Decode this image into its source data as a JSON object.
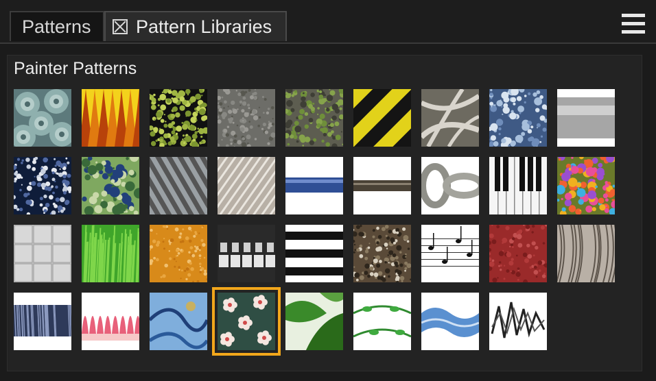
{
  "tabs": [
    {
      "label": "Patterns"
    },
    {
      "label": "Pattern Libraries"
    }
  ],
  "icons": {
    "tab_close": "close-box-icon",
    "panel_menu": "hamburger-menu-icon"
  },
  "accent_color": "#f2a71b",
  "section": {
    "title": "Painter Patterns"
  },
  "patterns": [
    {
      "name": "succulent"
    },
    {
      "name": "flames"
    },
    {
      "name": "moss"
    },
    {
      "name": "concrete"
    },
    {
      "name": "mossy-stone"
    },
    {
      "name": "caution-stripes"
    },
    {
      "name": "branches"
    },
    {
      "name": "blue-pebbles"
    },
    {
      "name": "metal-pipe"
    },
    {
      "name": "blue-splatter"
    },
    {
      "name": "green-blue-camo"
    },
    {
      "name": "steel-cable"
    },
    {
      "name": "rope"
    },
    {
      "name": "blue-rope"
    },
    {
      "name": "dark-rope"
    },
    {
      "name": "chain"
    },
    {
      "name": "piano-keys"
    },
    {
      "name": "confetti"
    },
    {
      "name": "stone-tiles"
    },
    {
      "name": "grass"
    },
    {
      "name": "orange-texture"
    },
    {
      "name": "zipper"
    },
    {
      "name": "wavy-bands"
    },
    {
      "name": "twigs"
    },
    {
      "name": "sheet-music"
    },
    {
      "name": "red-leather"
    },
    {
      "name": "tree-bark"
    },
    {
      "name": "blue-fur"
    },
    {
      "name": "pink-petals"
    },
    {
      "name": "blue-paisley"
    },
    {
      "name": "floral",
      "selected": true
    },
    {
      "name": "green-leaves"
    },
    {
      "name": "green-vines"
    },
    {
      "name": "blue-wave"
    },
    {
      "name": "ink-scribble"
    }
  ]
}
